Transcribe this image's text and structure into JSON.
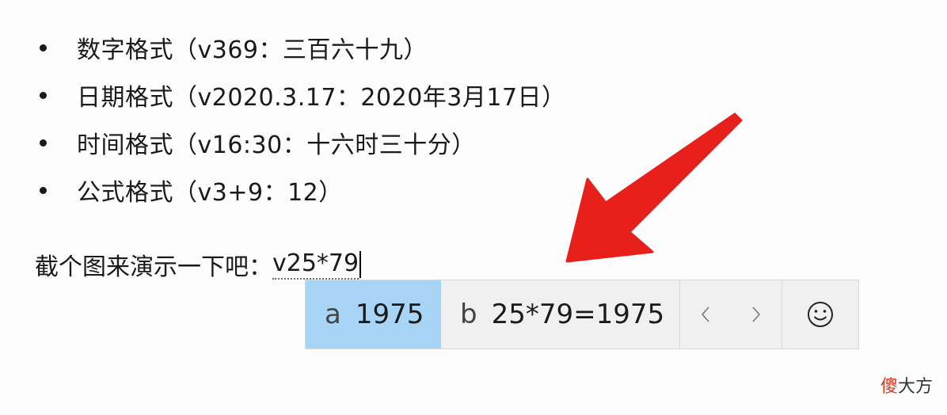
{
  "bullets": [
    {
      "label": "数字格式（v369：三百六十九）"
    },
    {
      "label": "日期格式（v2020.3.17：2020年3月17日）"
    },
    {
      "label": "时间格式（v16:30：十六时三十分）"
    },
    {
      "label": "公式格式（v3+9：12）"
    }
  ],
  "demo_line": {
    "prefix": "截个图来演示一下吧：",
    "composition": "v25*79"
  },
  "ime": {
    "candidates": [
      {
        "index": "a",
        "text": "1975",
        "selected": true
      },
      {
        "index": "b",
        "text": "25*79=1975",
        "selected": false
      }
    ],
    "prev_icon": "chevron-left-icon",
    "next_icon": "chevron-right-icon",
    "emoji_icon": "smiley-icon"
  },
  "watermark": {
    "red_part": "傻",
    "rest": "大方"
  },
  "colors": {
    "selected_candidate": "#a8d4f6",
    "arrow": "#e8201b",
    "watermark_red": "#d9381e"
  }
}
